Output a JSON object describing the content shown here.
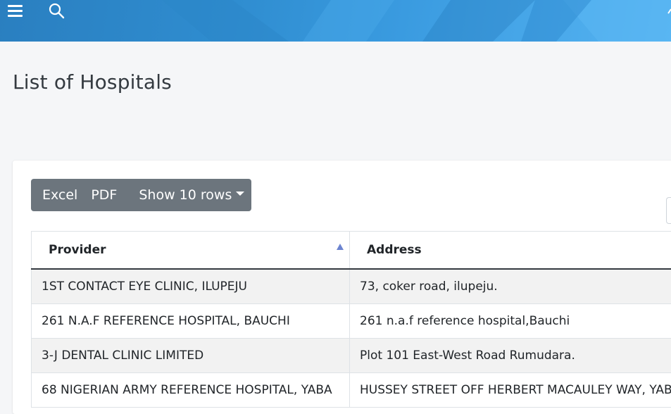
{
  "header": {
    "menu_icon": "hamburger-menu-icon",
    "search_icon": "search-icon",
    "gradient": [
      "#2a7fc0",
      "#56b4f2"
    ]
  },
  "page": {
    "title": "List of Hospitals"
  },
  "toolbar": {
    "excel_label": "Excel",
    "pdf_label": "PDF",
    "rows_label": "Show 10 rows",
    "button_color": "#6c757d"
  },
  "table": {
    "columns": [
      {
        "label": "Provider",
        "sorted": "ascending"
      },
      {
        "label": "Address"
      }
    ],
    "rows": [
      {
        "provider": "1ST CONTACT EYE CLINIC, ILUPEJU",
        "address": "73, coker road, ilupeju."
      },
      {
        "provider": "261 N.A.F REFERENCE HOSPITAL, BAUCHI",
        "address": "261 n.a.f reference hospital,Bauchi"
      },
      {
        "provider": "3-J DENTAL CLINIC LIMITED",
        "address": "Plot 101 East-West Road Rumudara."
      },
      {
        "provider": "68 NIGERIAN ARMY REFERENCE HOSPITAL, YABA",
        "address": "HUSSEY STREET OFF HERBERT MACAULEY WAY, YABA"
      }
    ]
  }
}
